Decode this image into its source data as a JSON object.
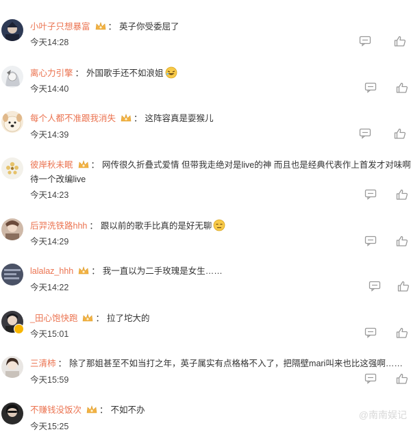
{
  "comments": [
    {
      "username": "小叶子只想暴富",
      "sep": "：",
      "text": "英子你受委屈了",
      "time": "今天14:28"
    },
    {
      "username": "离心力引擎",
      "sep": "：",
      "text": "外国歌手还不如浪姐",
      "time": "今天14:40"
    },
    {
      "username": "每个人都不准跟我消失",
      "sep": "：",
      "text": "这阵容真是耍猴儿",
      "time": "今天14:39"
    },
    {
      "username": "彼岸秋未眠",
      "sep": "：",
      "text": "网传很久折叠式爱情 但带我走绝对是live的神 而且也是经典代表作上首发才对味啊",
      "text2": "待一个改编live",
      "time": "今天14:23"
    },
    {
      "username": "后羿洗铁路hhh",
      "sep": "：",
      "text": "跟以前的歌手比真的是好无聊",
      "time": "今天14:29"
    },
    {
      "username": "lalalaz_hhh",
      "sep": "：",
      "text": "我一直以为二手玫瑰是女生……",
      "time": "今天14:22"
    },
    {
      "username": "_田心饱快跑",
      "sep": "：",
      "text": "拉了坨大的",
      "time": "今天15:01"
    },
    {
      "username": "三清柿",
      "sep": "：",
      "text": "除了那姐甚至不如当打之年，英子属实有点格格不入了，把隔壁mari叫来也比这强啊……",
      "time": "今天15:59"
    },
    {
      "username": "不赚钱没饭次",
      "sep": "：",
      "text": "不如不办",
      "time": "今天15:25"
    }
  ],
  "watermark": "@南南娱记",
  "icons": {
    "reply": "comment-icon",
    "like": "thumbs-up-icon",
    "badge": "crown-badge-icon"
  },
  "colors": {
    "username": "#eb7350",
    "text": "#333333",
    "icon": "#999999",
    "crown": "#f3b243"
  }
}
